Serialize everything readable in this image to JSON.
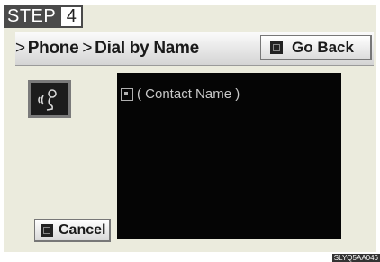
{
  "step": {
    "word": "STEP",
    "number": "4"
  },
  "header": {
    "breadcrumb": [
      ">",
      "Phone",
      ">",
      "Dial by Name"
    ],
    "go_back_label": "Go Back"
  },
  "list": {
    "items": [
      {
        "label": "( Contact Name )",
        "icon": "contact-icon"
      }
    ]
  },
  "footer": {
    "cancel_label": "Cancel"
  },
  "reference_code": "SLYQ5AA046",
  "colors": {
    "screen_bg": "#ebebdd",
    "list_bg": "#050505",
    "step_bg": "#4a4a4a"
  }
}
